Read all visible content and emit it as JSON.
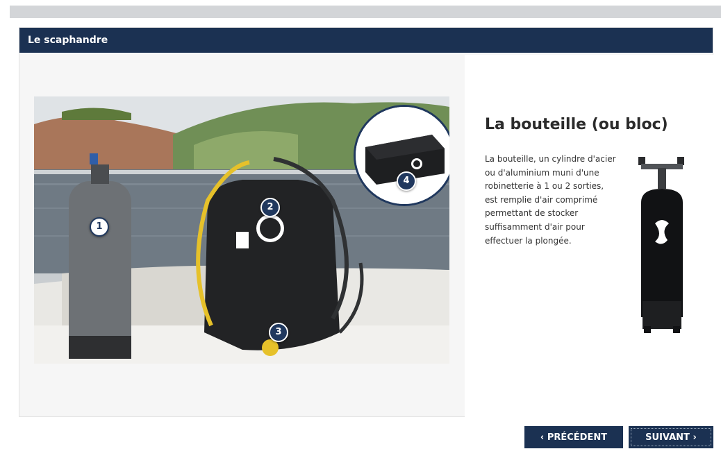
{
  "panel": {
    "header_title": "Le scaphandre"
  },
  "markers": [
    {
      "label": "1"
    },
    {
      "label": "2"
    },
    {
      "label": "3"
    },
    {
      "label": "4"
    }
  ],
  "info": {
    "title": "La bouteille (ou bloc)",
    "text": "La bouteille, un cylindre d'acier ou d'aluminium muni d'une robinetterie à 1 ou 2 sorties, est remplie d'air comprimé permettant de stocker suffisamment d'air pour effectuer la plongée."
  },
  "nav": {
    "prev_icon": "‹",
    "prev_label": "PRÉCÉDENT",
    "next_label": "SUIVANT",
    "next_icon": "›"
  },
  "colors": {
    "header_bg": "#1b3152",
    "marker_bg": "#20385e",
    "button_bg": "#1b3152"
  },
  "icons": {
    "prev": "chevron-left-icon",
    "next": "chevron-right-icon"
  }
}
